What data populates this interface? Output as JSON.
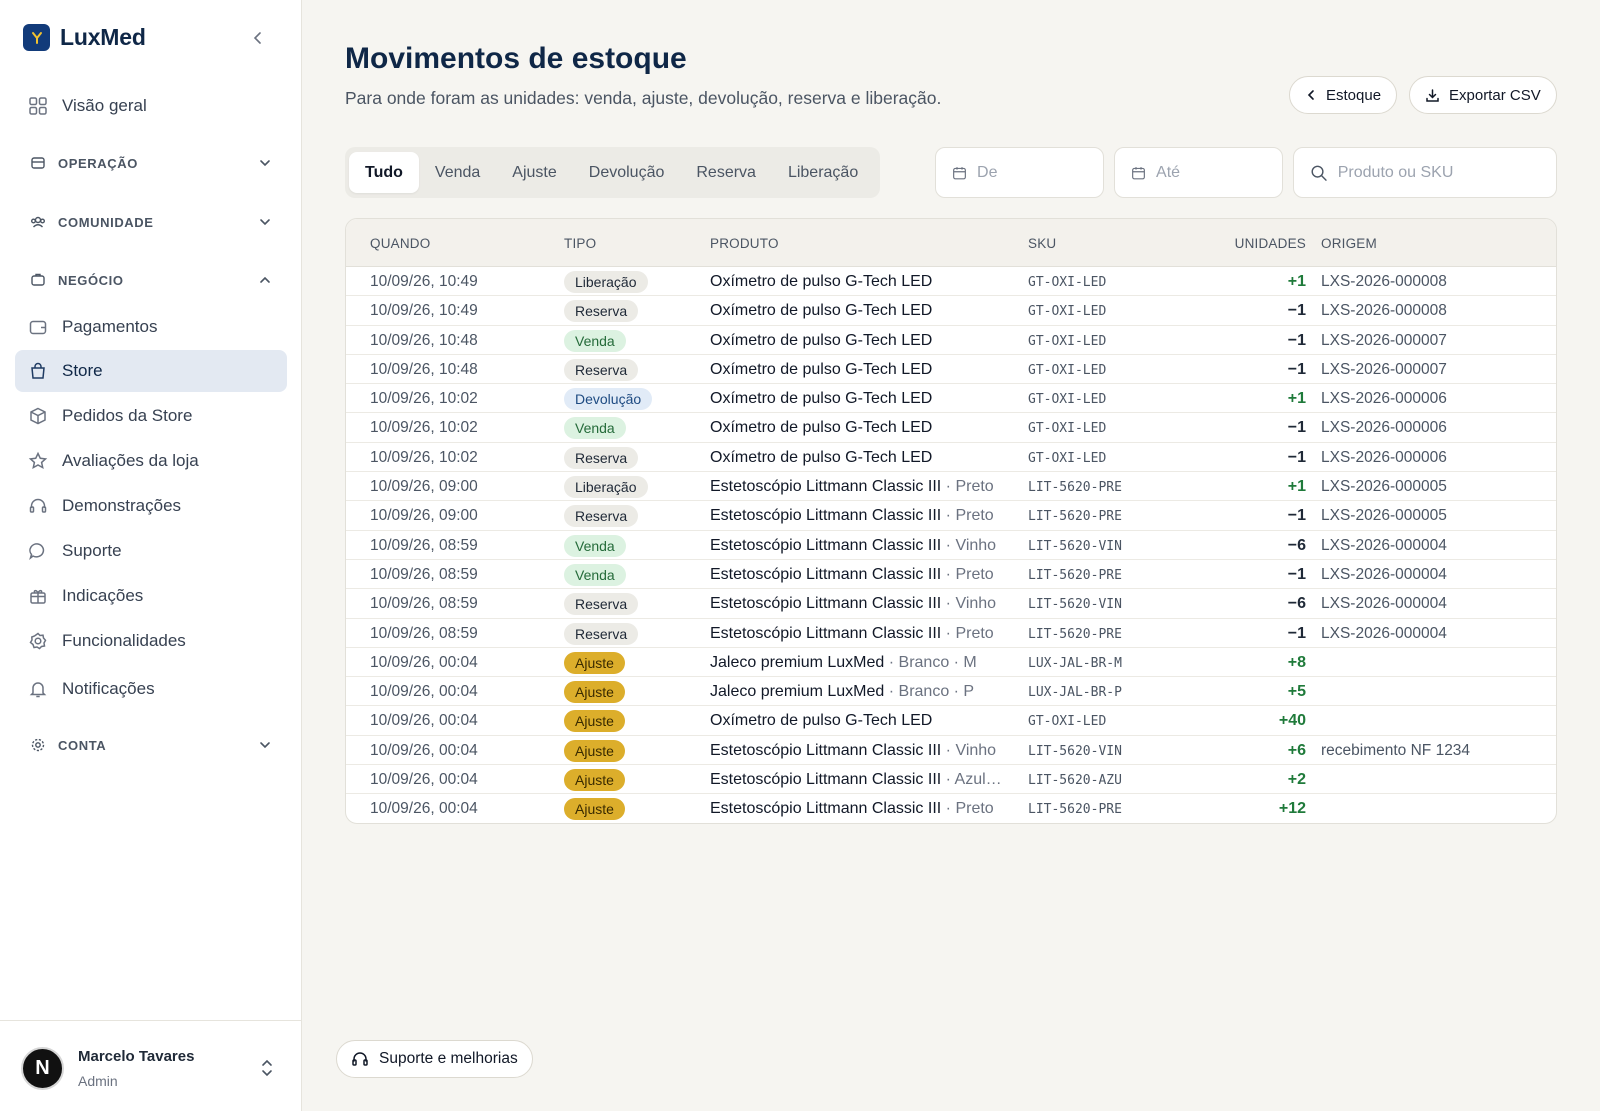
{
  "brand": {
    "name": "LuxMed",
    "accent": "#123b7a",
    "icon": "y-logo-icon"
  },
  "sidebar": {
    "collapse_icon": "chevron-left-icon",
    "top_item": {
      "label": "Visão geral",
      "icon": "grid-icon"
    },
    "sections": {
      "operacao": {
        "label": "OPERAÇÃO",
        "icon": "card-icon",
        "expanded": false
      },
      "comunidade": {
        "label": "COMUNIDADE",
        "icon": "users-icon",
        "expanded": false
      },
      "negocio": {
        "label": "NEGÓCIO",
        "icon": "briefcase-icon",
        "expanded": true
      },
      "conta": {
        "label": "CONTA",
        "icon": "gear-icon",
        "expanded": false
      }
    },
    "negocio_items": [
      {
        "label": "Pagamentos",
        "icon": "wallet-icon",
        "active": false
      },
      {
        "label": "Store",
        "icon": "bag-icon",
        "active": true
      },
      {
        "label": "Pedidos da Store",
        "icon": "package-icon",
        "active": false
      },
      {
        "label": "Avaliações da loja",
        "icon": "star-icon",
        "active": false
      },
      {
        "label": "Demonstrações",
        "icon": "headset-icon",
        "active": false
      },
      {
        "label": "Suporte",
        "icon": "chat-icon",
        "active": false
      },
      {
        "label": "Indicações",
        "icon": "gift-icon",
        "active": false
      },
      {
        "label": "Funcionalidades",
        "icon": "settings-icon",
        "active": false
      },
      {
        "label": "Notificações",
        "icon": "bell-icon",
        "active": false
      }
    ]
  },
  "user": {
    "initial": "N",
    "name": "Marcelo Tavares",
    "role": "Admin"
  },
  "header": {
    "title": "Movimentos de estoque",
    "subtitle": "Para onde foram as unidades: venda, ajuste, devolução, reserva e liberação.",
    "back_label": "Estoque",
    "export_label": "Exportar CSV"
  },
  "filters": {
    "tabs": [
      "Tudo",
      "Venda",
      "Ajuste",
      "Devolução",
      "Reserva",
      "Liberação"
    ],
    "active_tab": "Tudo",
    "date_from_placeholder": "De",
    "date_to_placeholder": "Até",
    "search_placeholder": "Produto ou SKU"
  },
  "table": {
    "columns": [
      "QUANDO",
      "TIPO",
      "PRODUTO",
      "SKU",
      "UNIDADES",
      "ORIGEM"
    ],
    "rows": [
      {
        "when": "10/09/26, 10:49",
        "type": "Liberação",
        "product": "Oxímetro de pulso G-Tech LED",
        "variant": "",
        "sku": "GT-OXI-LED",
        "units": "+1",
        "origin": "LXS-2026-000008"
      },
      {
        "when": "10/09/26, 10:49",
        "type": "Reserva",
        "product": "Oxímetro de pulso G-Tech LED",
        "variant": "",
        "sku": "GT-OXI-LED",
        "units": "−1",
        "origin": "LXS-2026-000008"
      },
      {
        "when": "10/09/26, 10:48",
        "type": "Venda",
        "product": "Oxímetro de pulso G-Tech LED",
        "variant": "",
        "sku": "GT-OXI-LED",
        "units": "−1",
        "origin": "LXS-2026-000007"
      },
      {
        "when": "10/09/26, 10:48",
        "type": "Reserva",
        "product": "Oxímetro de pulso G-Tech LED",
        "variant": "",
        "sku": "GT-OXI-LED",
        "units": "−1",
        "origin": "LXS-2026-000007"
      },
      {
        "when": "10/09/26, 10:02",
        "type": "Devolução",
        "product": "Oxímetro de pulso G-Tech LED",
        "variant": "",
        "sku": "GT-OXI-LED",
        "units": "+1",
        "origin": "LXS-2026-000006"
      },
      {
        "when": "10/09/26, 10:02",
        "type": "Venda",
        "product": "Oxímetro de pulso G-Tech LED",
        "variant": "",
        "sku": "GT-OXI-LED",
        "units": "−1",
        "origin": "LXS-2026-000006"
      },
      {
        "when": "10/09/26, 10:02",
        "type": "Reserva",
        "product": "Oxímetro de pulso G-Tech LED",
        "variant": "",
        "sku": "GT-OXI-LED",
        "units": "−1",
        "origin": "LXS-2026-000006"
      },
      {
        "when": "10/09/26, 09:00",
        "type": "Liberação",
        "product": "Estetoscópio Littmann Classic III",
        "variant": " · Preto",
        "sku": "LIT-5620-PRE",
        "units": "+1",
        "origin": "LXS-2026-000005"
      },
      {
        "when": "10/09/26, 09:00",
        "type": "Reserva",
        "product": "Estetoscópio Littmann Classic III",
        "variant": " · Preto",
        "sku": "LIT-5620-PRE",
        "units": "−1",
        "origin": "LXS-2026-000005"
      },
      {
        "when": "10/09/26, 08:59",
        "type": "Venda",
        "product": "Estetoscópio Littmann Classic III",
        "variant": " · Vinho",
        "sku": "LIT-5620-VIN",
        "units": "−6",
        "origin": "LXS-2026-000004"
      },
      {
        "when": "10/09/26, 08:59",
        "type": "Venda",
        "product": "Estetoscópio Littmann Classic III",
        "variant": " · Preto",
        "sku": "LIT-5620-PRE",
        "units": "−1",
        "origin": "LXS-2026-000004"
      },
      {
        "when": "10/09/26, 08:59",
        "type": "Reserva",
        "product": "Estetoscópio Littmann Classic III",
        "variant": " · Vinho",
        "sku": "LIT-5620-VIN",
        "units": "−6",
        "origin": "LXS-2026-000004"
      },
      {
        "when": "10/09/26, 08:59",
        "type": "Reserva",
        "product": "Estetoscópio Littmann Classic III",
        "variant": " · Preto",
        "sku": "LIT-5620-PRE",
        "units": "−1",
        "origin": "LXS-2026-000004"
      },
      {
        "when": "10/09/26, 00:04",
        "type": "Ajuste",
        "product": "Jaleco premium LuxMed",
        "variant": " · Branco · M",
        "sku": "LUX-JAL-BR-M",
        "units": "+8",
        "origin": ""
      },
      {
        "when": "10/09/26, 00:04",
        "type": "Ajuste",
        "product": "Jaleco premium LuxMed",
        "variant": " · Branco · P",
        "sku": "LUX-JAL-BR-P",
        "units": "+5",
        "origin": ""
      },
      {
        "when": "10/09/26, 00:04",
        "type": "Ajuste",
        "product": "Oxímetro de pulso G-Tech LED",
        "variant": "",
        "sku": "GT-OXI-LED",
        "units": "+40",
        "origin": ""
      },
      {
        "when": "10/09/26, 00:04",
        "type": "Ajuste",
        "product": "Estetoscópio Littmann Classic III",
        "variant": " · Vinho",
        "sku": "LIT-5620-VIN",
        "units": "+6",
        "origin": "recebimento NF 1234"
      },
      {
        "when": "10/09/26, 00:04",
        "type": "Ajuste",
        "product": "Estetoscópio Littmann Classic III",
        "variant": " · Azul…",
        "sku": "LIT-5620-AZU",
        "units": "+2",
        "origin": ""
      },
      {
        "when": "10/09/26, 00:04",
        "type": "Ajuste",
        "product": "Estetoscópio Littmann Classic III",
        "variant": " · Preto",
        "sku": "LIT-5620-PRE",
        "units": "+12",
        "origin": ""
      }
    ]
  },
  "badge_colors": {
    "Liberação": {
      "bg": "#ecebe6",
      "fg": "#1f2937"
    },
    "Reserva": {
      "bg": "#ecebe6",
      "fg": "#1f2937"
    },
    "Venda": {
      "bg": "#dcf2e1",
      "fg": "#256b3a"
    },
    "Devolução": {
      "bg": "#e1ebf7",
      "fg": "#1e4b82"
    },
    "Ajuste": {
      "bg": "#dcae2b",
      "fg": "#3a2b00"
    }
  },
  "unit_colors": {
    "positive": "#1f7a3a",
    "negative": "#1f2937"
  },
  "footer": {
    "support_label": "Suporte e melhorias"
  }
}
